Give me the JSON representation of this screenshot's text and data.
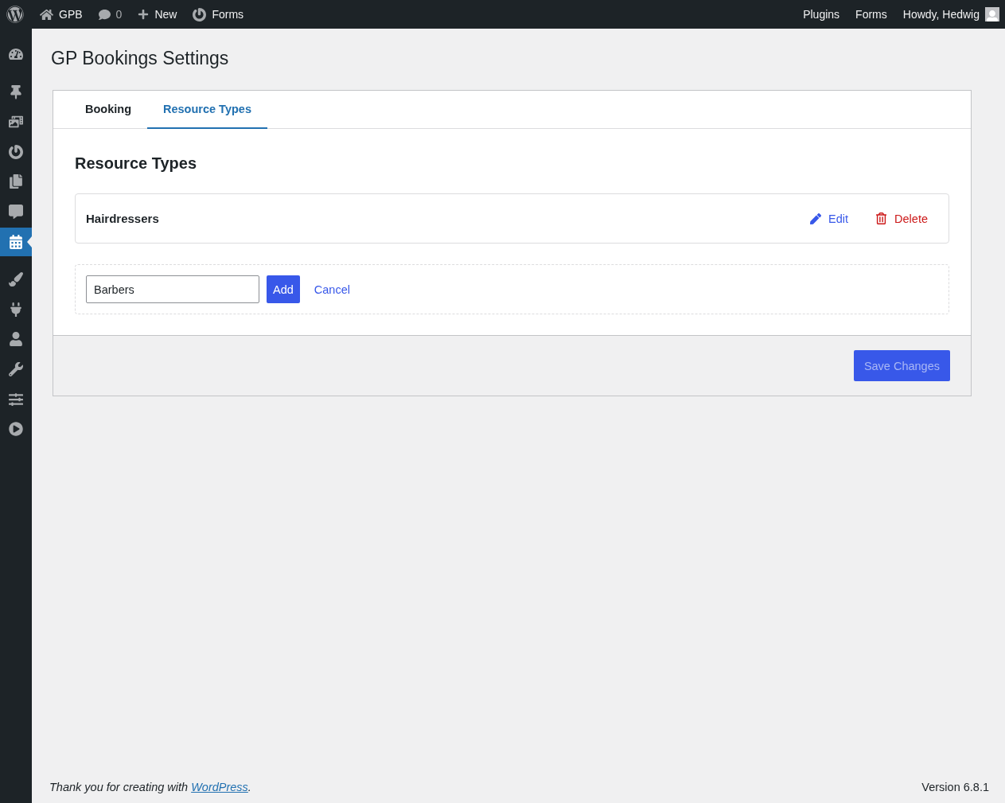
{
  "admin_bar": {
    "site": "GPB",
    "comments": "0",
    "new": "New",
    "forms": "Forms",
    "right_links": [
      "Plugins",
      "Forms"
    ],
    "greeting": "Howdy, Hedwig"
  },
  "sidebar": {
    "items": [
      {
        "selected": false
      },
      {
        "selected": false
      },
      {
        "selected": false
      },
      {
        "selected": false
      },
      {
        "selected": false
      },
      {
        "selected": false
      },
      {
        "selected": true
      },
      {
        "selected": false
      },
      {
        "selected": false
      },
      {
        "selected": false
      },
      {
        "selected": false
      },
      {
        "selected": false
      },
      {
        "selected": false
      }
    ]
  },
  "page_title": "GP Bookings Settings",
  "tabs": [
    {
      "label": "Booking",
      "selected": false
    },
    {
      "label": "Resource Types",
      "selected": true
    }
  ],
  "section_title": "Resource Types",
  "resource_types": [
    {
      "name": "Hairdressers",
      "edit": "Edit",
      "delete": "Delete"
    }
  ],
  "add_form": {
    "value": "Barbers",
    "add": "Add",
    "cancel": "Cancel"
  },
  "save_button": {
    "label": "Save Changes",
    "disabled": true
  },
  "footer": {
    "thanks": "Thank you for creating with ",
    "link": "WordPress",
    "thanks_end": ".",
    "version": "Version 6.8.1"
  }
}
